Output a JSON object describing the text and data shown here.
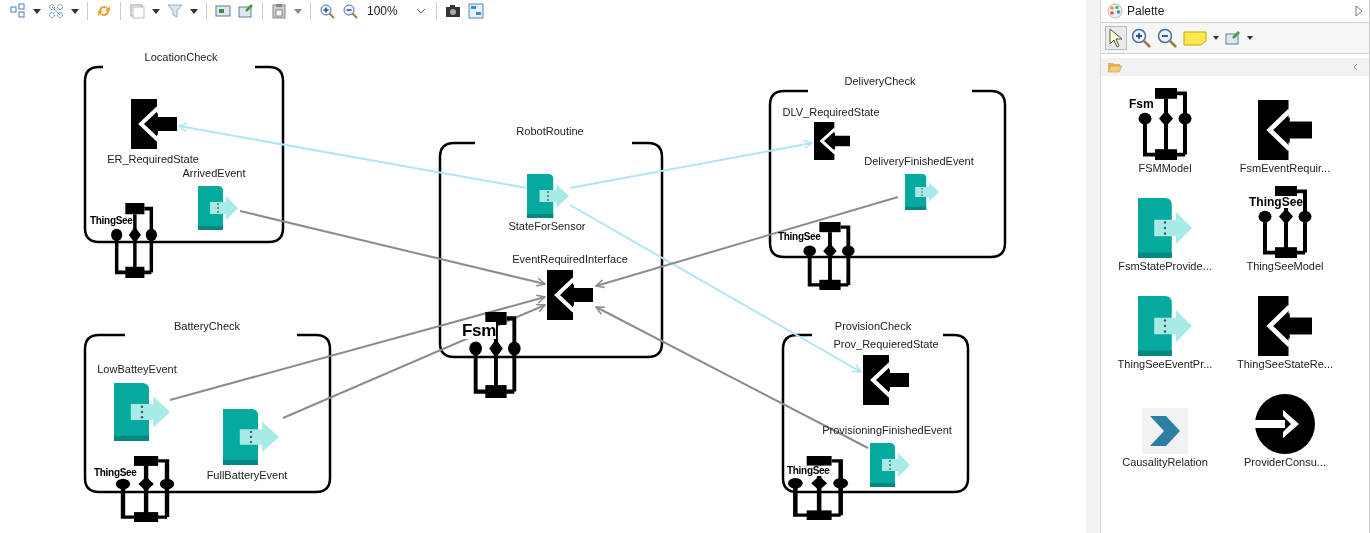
{
  "toolbar": {
    "zoom": "100%"
  },
  "diagram": {
    "containers": [
      {
        "title": "LocationCheck",
        "children": [
          {
            "kind": "required",
            "label": "ER_RequiredState"
          },
          {
            "kind": "provider",
            "label": "ArrivedEvent"
          },
          {
            "kind": "model",
            "label": "ThingSee"
          }
        ]
      },
      {
        "title": "RobotRoutine",
        "children": [
          {
            "kind": "provider",
            "label": "StateForSensor"
          },
          {
            "kind": "required",
            "label": "EventRequiredInterface"
          },
          {
            "kind": "model",
            "label": "Fsm"
          }
        ]
      },
      {
        "title": "DeliveryCheck",
        "children": [
          {
            "kind": "required",
            "label": "DLV_RequiredState"
          },
          {
            "kind": "provider",
            "label": "DeliveryFinishedEvent"
          },
          {
            "kind": "model",
            "label": "ThingSee"
          }
        ]
      },
      {
        "title": "BatteryCheck",
        "children": [
          {
            "kind": "provider",
            "label": "LowBatteyEvent"
          },
          {
            "kind": "model",
            "label": "ThingSee"
          },
          {
            "kind": "provider",
            "label": "FullBatteryEvent"
          }
        ]
      },
      {
        "title": "ProvisionCheck",
        "children": [
          {
            "kind": "required",
            "label": "Prov_RequieredState"
          },
          {
            "kind": "provider",
            "label": "ProvisioningFinishedEvent"
          },
          {
            "kind": "model",
            "label": "ThingSee"
          }
        ]
      }
    ],
    "connections": [
      {
        "kind": "state"
      },
      {
        "kind": "state"
      },
      {
        "kind": "state"
      },
      {
        "kind": "event"
      },
      {
        "kind": "event"
      },
      {
        "kind": "event"
      },
      {
        "kind": "event"
      },
      {
        "kind": "event"
      }
    ]
  },
  "palette": {
    "title": "Palette",
    "rows": [
      {
        "entries": [
          {
            "kind": "model",
            "badge": "Fsm",
            "label": "FSMModel"
          },
          {
            "kind": "required",
            "label": "FsmEventRequir..."
          }
        ]
      },
      {
        "entries": [
          {
            "kind": "provider",
            "label": "FsmStateProvide..."
          },
          {
            "kind": "model",
            "badge": "ThingSee",
            "label": "ThingSeeModel"
          }
        ]
      },
      {
        "entries": [
          {
            "kind": "provider",
            "label": "ThingSeeEventPr..."
          },
          {
            "kind": "required",
            "label": "ThingSeeStateRe..."
          }
        ]
      },
      {
        "entries": [
          {
            "kind": "causality",
            "label": "CausalityRelation"
          },
          {
            "kind": "consumer",
            "label": "ProviderConsu..."
          }
        ]
      }
    ]
  }
}
